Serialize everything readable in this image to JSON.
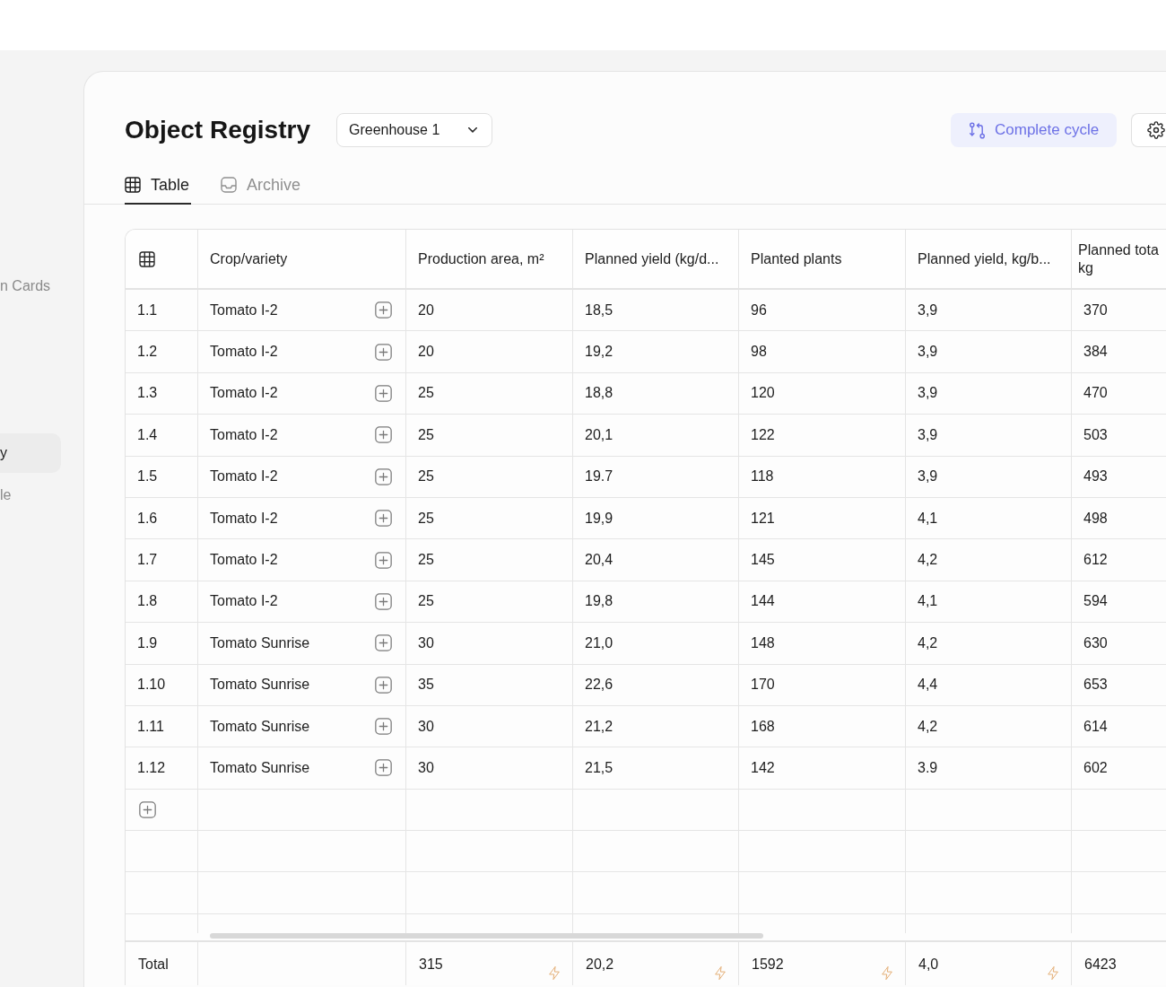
{
  "sidebar": {
    "items": [
      {
        "label": "n Cards",
        "selected": false
      },
      {
        "label": "y",
        "selected": true
      },
      {
        "label": "le",
        "selected": false
      }
    ]
  },
  "header": {
    "title": "Object Registry",
    "select": {
      "value": "Greenhouse 1"
    },
    "actions": [
      {
        "kind": "primary",
        "label": "Complete cycle"
      },
      {
        "kind": "settings"
      }
    ]
  },
  "tabs": [
    {
      "label": "Table",
      "selected": true
    },
    {
      "label": "Archive",
      "selected": false
    }
  ],
  "table": {
    "columns": [
      "Crop/variety",
      "Production area, m²",
      "Planned yield (kg/d...",
      "Planted plants",
      "Planned yield, kg/b...",
      "Planned tota kg"
    ],
    "rows": [
      {
        "number": "1.1",
        "cells": [
          "Tomato I-2",
          "20",
          "18,5",
          "96",
          "3,9",
          "370"
        ]
      },
      {
        "number": "1.2",
        "cells": [
          "Tomato I-2",
          "20",
          "19,2",
          "98",
          "3,9",
          "384"
        ]
      },
      {
        "number": "1.3",
        "cells": [
          "Tomato I-2",
          "25",
          "18,8",
          "120",
          "3,9",
          "470"
        ]
      },
      {
        "number": "1.4",
        "cells": [
          "Tomato I-2",
          "25",
          "20,1",
          "122",
          "3,9",
          "503"
        ]
      },
      {
        "number": "1.5",
        "cells": [
          "Tomato I-2",
          "25",
          "19.7",
          "118",
          "3,9",
          "493"
        ]
      },
      {
        "number": "1.6",
        "cells": [
          "Tomato I-2",
          "25",
          "19,9",
          "121",
          "4,1",
          "498"
        ]
      },
      {
        "number": "1.7",
        "cells": [
          "Tomato I-2",
          "25",
          "20,4",
          "145",
          "4,2",
          "612"
        ]
      },
      {
        "number": "1.8",
        "cells": [
          "Tomato I-2",
          "25",
          "19,8",
          "144",
          "4,1",
          "594"
        ]
      },
      {
        "number": "1.9",
        "cells": [
          "Tomato Sunrise",
          "30",
          "21,0",
          "148",
          "4,2",
          "630"
        ]
      },
      {
        "number": "1.10",
        "cells": [
          "Tomato Sunrise",
          "35",
          "22,6",
          "170",
          "4,4",
          "653"
        ]
      },
      {
        "number": "1.11",
        "cells": [
          "Tomato Sunrise",
          "30",
          "21,2",
          "168",
          "4,2",
          "614"
        ]
      },
      {
        "number": "1.12",
        "cells": [
          "Tomato Sunrise",
          "30",
          "21,5",
          "142",
          "3.9",
          "602"
        ]
      }
    ],
    "footer": {
      "label": "Total",
      "values": [
        {
          "text": "315",
          "formula": true
        },
        {
          "text": "20,2",
          "formula": true
        },
        {
          "text": "1592",
          "formula": true
        },
        {
          "text": "4,0",
          "formula": true
        },
        {
          "text": "6423"
        }
      ]
    }
  }
}
